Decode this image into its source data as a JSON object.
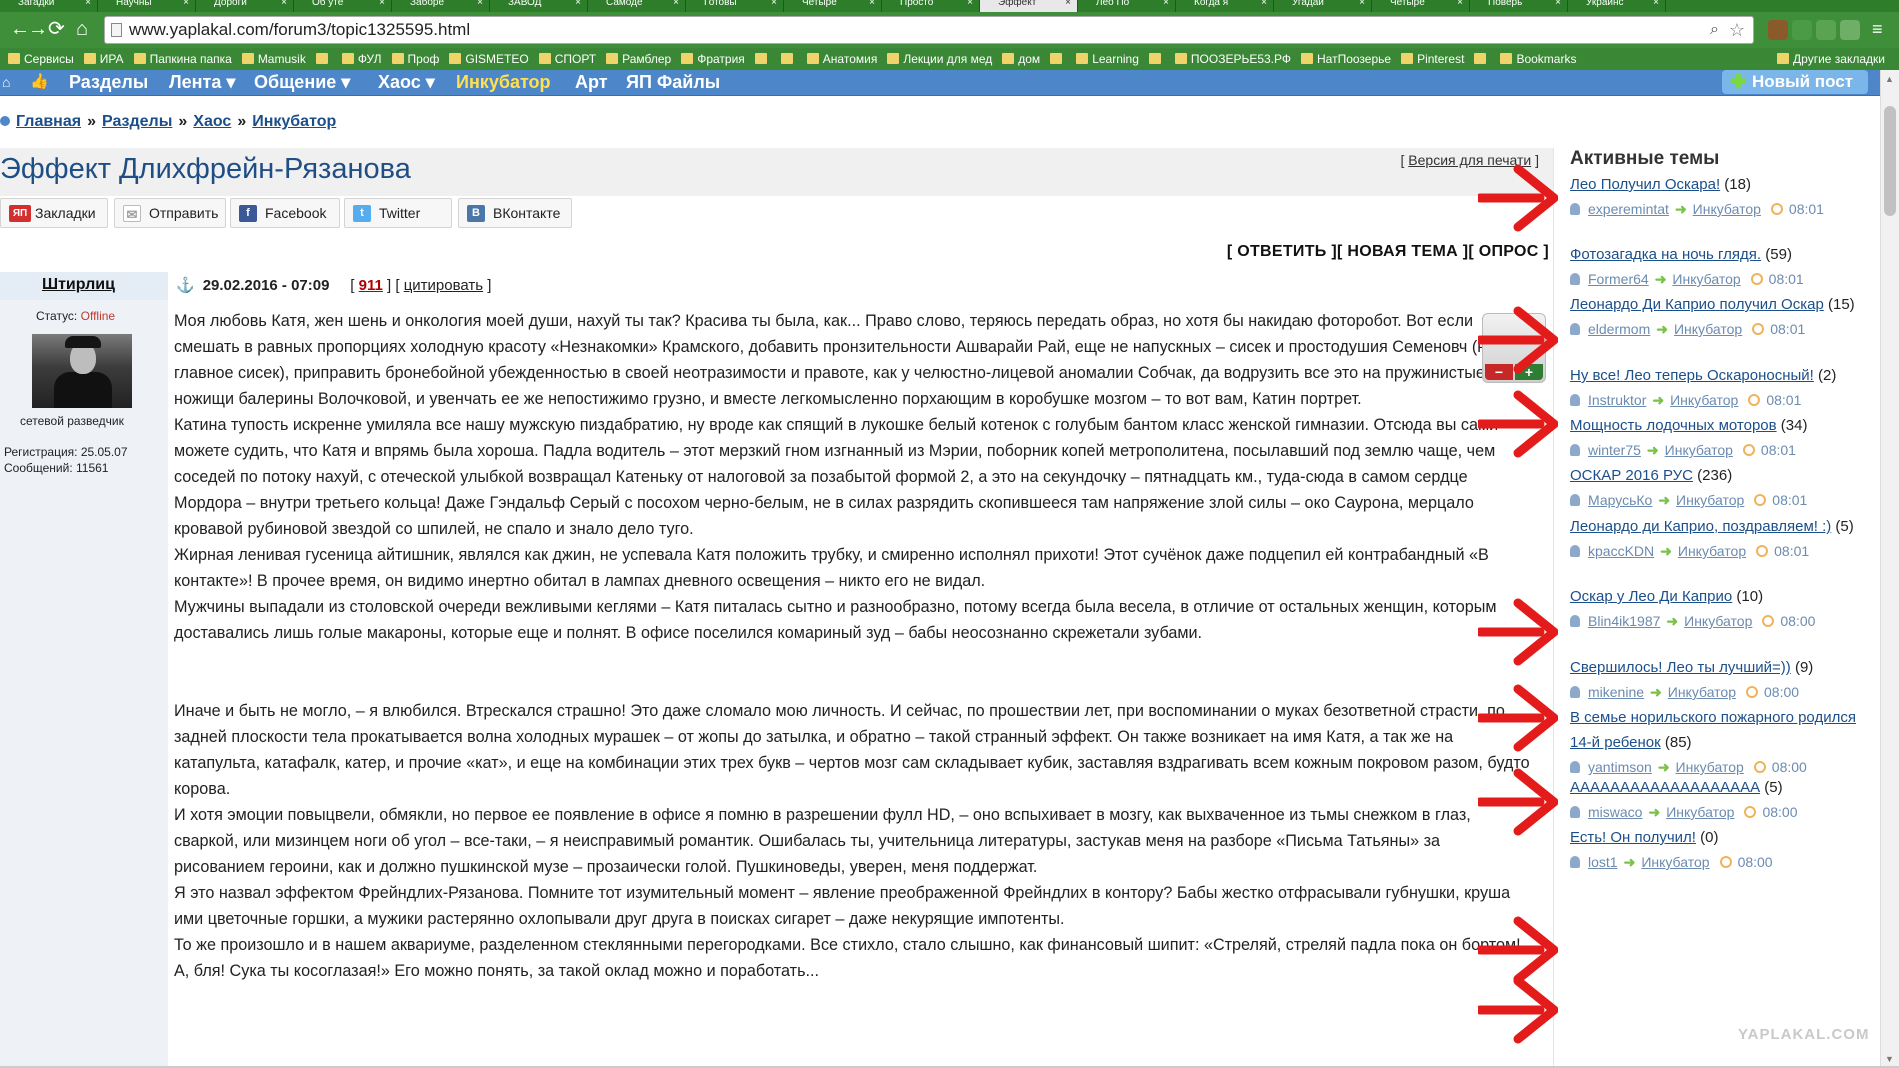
{
  "browser": {
    "tabs": [
      "Загадки",
      "Научны",
      "Дороги",
      "Об уте",
      "Заборе",
      "ЗАВОД",
      "Самоде",
      "Готовы",
      "Четыре",
      "Просто",
      "Эффект",
      "Лео По",
      "Когда я",
      "Угадай",
      "Четыре",
      "Поверь",
      "Украинс"
    ],
    "url": "www.yaplakal.com/forum3/topic1325595.html",
    "nav": {
      "back": "←",
      "forward": "→",
      "reload": "⟳",
      "home": "⌂"
    },
    "zoom_icon": "magnifier-icon",
    "star_icon": "☆",
    "bookmarks": [
      "Сервисы",
      "ИРА",
      "Папкина папка",
      "Mamusik",
      "",
      "ФУЛ",
      "Проф",
      "GISMETEO",
      "СПОРТ",
      "Рамблер",
      "Фратрия",
      "",
      "",
      "Анатомия",
      "Лекции для мед",
      "дом",
      "",
      "Learning",
      "",
      "ПООЗЕРЬЕ53.РФ",
      "НатПоозерье",
      "Pinterest",
      "",
      "Bookmarks"
    ],
    "other_bookmarks": "Другие закладки"
  },
  "site_nav": {
    "home_icon": "⌂",
    "like_icon": "👍",
    "items": [
      "Разделы",
      "Лента ▾",
      "Общение ▾",
      "Хаос ▾",
      "Инкубатор",
      "Арт",
      "ЯП Файлы"
    ],
    "new_post": "Новый пост"
  },
  "breadcrumb": [
    "Главная",
    "Разделы",
    "Хаос",
    "Инкубатор"
  ],
  "breadcrumb_sep": "»",
  "topic": {
    "title": "Эффект Длихфрейн-Рязанова",
    "print_version": "Версия для печати",
    "print_brackets": [
      "[",
      "]"
    ]
  },
  "share": [
    {
      "label": "Закладки",
      "icon": "ЯП",
      "color": "#d32f2f"
    },
    {
      "label": "Отправить",
      "icon": "✉",
      "color": "#9e9e9e"
    },
    {
      "label": "Facebook",
      "icon": "f",
      "color": "#3b5998"
    },
    {
      "label": "Twitter",
      "icon": "t",
      "color": "#55acee"
    },
    {
      "label": "ВКонтакте",
      "icon": "B",
      "color": "#4a76a8"
    }
  ],
  "actions": {
    "reply": "ОТВЕТИТЬ",
    "new_topic": "НОВАЯ ТЕМА",
    "poll": "ОПРОС",
    "open": "[ ",
    "close": " ]"
  },
  "post": {
    "author": "Штирлиц",
    "anchor_icon": "⚓",
    "date": "29.02.2016 - 07:09",
    "number": "911",
    "quote": "цитировать",
    "status_label": "Статус:",
    "status": "Offline",
    "rank": "сетевой разведчик",
    "registration": "Регистрация: 25.05.07",
    "messages": "Сообщений: 11561",
    "vote_minus": "−",
    "vote_plus": "+",
    "paragraphs": [
      "Моя любовь Катя, жен шень и онкология моей души, нахуй ты так? Красива ты была, как... Право слово, теряюсь передать образ, но хотя бы накидаю фоторобот. Вот если смешать в равных пропорциях холодную красоту «Незнакомки» Крамского, добавить пронзительности Ашварайи Рай, еще не напускных – сисек и простодушия Семеновч (но главное сисек), приправить бронебойной убежденностью в своей неотразимости и правоте, как у челюстно-лицевой аномалии Собчак, да водрузить все это на пружинистые ножищи балерины Волочковой, и увенчать ее же непостижимо грузно, и вместе легкомысленно порхающим в коробушке мозгом – то вот вам, Катин портрет.",
      "Катина тупость искренне умиляла все нашу мужскую пиздабратию, ну вроде как спящий в лукошке белый котенок с голубым бантом класс женской гимназии. Отсюда вы сами можете судить, что Катя и впрямь была хороша. Падла водитель – этот мерзкий гном изгнанный из Мэрии, поборник копей метрополитена, посылавший под землю чаще, чем соседей по потоку нахуй, с отеческой улыбкой возвращал Катеньку от налоговой за позабытой формой 2, а это на секундочку – пятнадцать км., туда-сюда в самом сердце Мордора – внутри третьего кольца! Даже Гэндальф Серый с посохом черно-белым, не в силах разрядить скопившееся там напряжение злой силы – око Саурона, мерцало кровавой рубиновой звездой со шпилей, не спало и знало дело туго.",
      "Жирная ленивая гусеница айтишник, являлся как джин, не успевала Катя положить трубку, и смиренно исполнял прихоти! Этот сучёнок даже подцепил ей контрабандный «В контакте»! В прочее время, он видимо инертно обитал в лампах дневного освещения – никто его не видал.",
      "Мужчины выпадали из столовской очереди вежливыми кеглями – Катя питалась сытно и разнообразно, потому всегда была весела, в отличие от остальных женщин, которым доставались лишь голые макароны, которые еще и полнят. В офисе поселился комариный зуд – бабы неосознанно скрежетали зубами.",
      "Иначе и быть не могло, – я влюбился. Втрескался страшно! Это даже сломало мою личность. И сейчас, по прошествии лет, при воспоминании о муках безответной страсти, по задней плоскости тела прокатывается волна холодных мурашек – от жопы до затылка, и обратно – такой странный эффект. Он также возникает на имя Катя, а так же на катапульта, катафалк, катер, и прочие «кат», и еще на комбинации этих трех букв – чертов мозг сам складывает кубик, заставляя вздрагивать всем кожным покровом разом, будто корова.",
      "И хотя эмоции повыцвели, обмякли, но первое ее появление в офисе я помню в разрешении фулл HD, – оно вспыхивает в мозгу, как выхваченное из тьмы снежком в глаз, сваркой, или мизинцем ноги об угол – все-таки, – я неисправимый романтик. Ошибалась ты, учительница литературы, застукав меня на разборе «Письма Татьяны» за рисованием героини, как и должно пушкинской музе – прозаически голой. Пушкиноведы, уверен, меня поддержат.",
      "Я это назвал эффектом Фрейндлих-Рязанова. Помните тот изумительный момент – явление преображенной Фрейндлих в контору? Бабы жестко отфрасывали губнушки, круша ими цветочные горшки, а мужики растерянно охлопывали друг друга в поисках сигарет – даже некурящие импотенты.",
      "То же произошло и в нашем аквариуме, разделенном стеклянными перегородками. Все стихло, стало слышно, как финансовый шипит: «Стреляй, стреляй падла пока он бортом! А, бля! Сука ты косоглазая!» Его можно понять, за такой оклад можно и поработать..."
    ]
  },
  "sidebar": {
    "title": "Активные темы",
    "topics": [
      {
        "title": "Лео Получил Оскара!",
        "count": "(18)",
        "user": "experemintat",
        "section": "Инкубатор",
        "time": "08:01"
      },
      {
        "title": "Фотозагадка на ночь глядя.",
        "count": "(59)",
        "user": "Former64",
        "section": "Инкубатор",
        "time": "08:01"
      },
      {
        "title": "Леонардо Ди Каприо получил Оскар",
        "count": "(15)",
        "user": "eldermom",
        "section": "Инкубатор",
        "time": "08:01"
      },
      {
        "title": "Ну все! Лео теперь Оскароносный!",
        "count": "(2)",
        "user": "Instruktor",
        "section": "Инкубатор",
        "time": "08:01"
      },
      {
        "title": "Мощность лодочных моторов",
        "count": "(34)",
        "user": "winter75",
        "section": "Инкубатор",
        "time": "08:01"
      },
      {
        "title": "ОСКАР 2016 РУС",
        "count": "(236)",
        "user": "МарусьКо",
        "section": "Инкубатор",
        "time": "08:01"
      },
      {
        "title": "Леонардо ди Каприо, поздравляем! :)",
        "count": "(5)",
        "user": "kpaccKDN",
        "section": "Инкубатор",
        "time": "08:01"
      },
      {
        "title": "Оскар у Лео Ди Каприо",
        "count": "(10)",
        "user": "Blin4ik1987",
        "section": "Инкубатор",
        "time": "08:00"
      },
      {
        "title": "Свершилось! Лео ты лучший=))",
        "count": "(9)",
        "user": "mikenine",
        "section": "Инкубатор",
        "time": "08:00"
      },
      {
        "title": "В семье норильского пожарного родился 14-й ребенок",
        "count": "(85)",
        "user": "yantimson",
        "section": "Инкубатор",
        "time": "08:00"
      },
      {
        "title": "ААААААААААААААААААА",
        "count": "(5)",
        "user": "miswaco",
        "section": "Инкубатор",
        "time": "08:00"
      },
      {
        "title": "Есть! Он получил!",
        "count": "(0)",
        "user": "lost1",
        "section": "Инкубатор",
        "time": "08:00"
      }
    ]
  },
  "watermark": "YAPLAKAL.COM",
  "colors": {
    "accent": "#4d86c9",
    "arrow": "#e31b1b",
    "link": "#1c4f8a"
  }
}
